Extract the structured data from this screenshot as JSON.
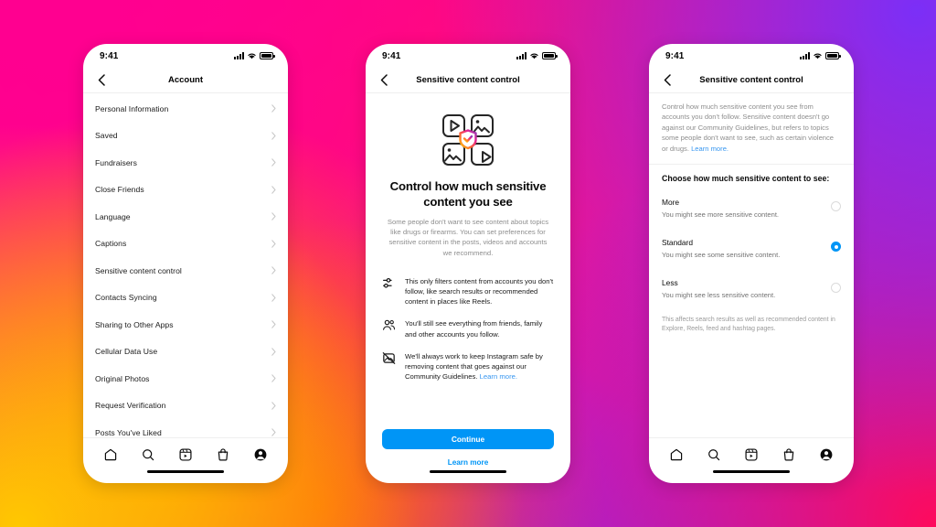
{
  "background": {
    "colors": [
      "#ff0090",
      "#ff0d7a",
      "#ff4a18",
      "#ff9000",
      "#ffc800",
      "#b01fd2",
      "#7b2ff7",
      "#ff0a5c"
    ]
  },
  "accent": {
    "blue": "#0095f6",
    "link": "#3897f0",
    "selected": "#0095f6"
  },
  "status_bar": {
    "time": "9:41",
    "signal_icon": "cellular-bars-icon",
    "wifi_icon": "wifi-icon",
    "battery_icon": "battery-full-icon"
  },
  "tab_bar": {
    "items": [
      {
        "name": "home-tab",
        "icon": "home-icon"
      },
      {
        "name": "search-tab",
        "icon": "search-icon"
      },
      {
        "name": "reels-tab",
        "icon": "reels-icon"
      },
      {
        "name": "shop-tab",
        "icon": "shopping-bag-icon"
      },
      {
        "name": "profile-tab",
        "icon": "profile-person-icon"
      }
    ]
  },
  "phone1": {
    "nav": {
      "back_icon": "chevron-left-icon",
      "title": "Account"
    },
    "list": [
      {
        "label": "Personal Information"
      },
      {
        "label": "Saved"
      },
      {
        "label": "Fundraisers"
      },
      {
        "label": "Close Friends"
      },
      {
        "label": "Language"
      },
      {
        "label": "Captions"
      },
      {
        "label": "Sensitive content control"
      },
      {
        "label": "Contacts Syncing"
      },
      {
        "label": "Sharing to Other Apps"
      },
      {
        "label": "Cellular Data Use"
      },
      {
        "label": "Original Photos"
      },
      {
        "label": "Request Verification"
      },
      {
        "label": "Posts You've Liked"
      }
    ]
  },
  "phone2": {
    "nav": {
      "back_icon": "chevron-left-icon",
      "title": "Sensitive content control"
    },
    "illustration": "shield-check-media-grid-illustration",
    "heading": "Control how much sensitive content you see",
    "subtext": "Some people don't want to see content about topics like drugs or firearms. You can set preferences for sensitive content in the posts, videos and accounts we recommend.",
    "bullets": [
      {
        "icon": "sliders-filter-icon",
        "text": "This only filters content from accounts you don't follow, like search results or recommended content in places like Reels."
      },
      {
        "icon": "people-group-icon",
        "text": "You'll still see everything from friends, family and other accounts you follow."
      },
      {
        "icon": "photo-slash-icon",
        "text": "We'll always work to keep Instagram safe by removing content that goes against our Community Guidelines. ",
        "link": "Learn more."
      }
    ],
    "continue_label": "Continue",
    "learn_more_label": "Learn more"
  },
  "phone3": {
    "nav": {
      "back_icon": "chevron-left-icon",
      "title": "Sensitive content control"
    },
    "intro": "Control how much sensitive content you see from accounts you don't follow. Sensitive content doesn't go against our Community Guidelines, but refers to topics some people don't want to see, such as certain violence or drugs. ",
    "intro_link": "Learn more.",
    "section_heading": "Choose how much sensitive content to see:",
    "options": [
      {
        "title": "More",
        "desc": "You might see more sensitive content.",
        "selected": false
      },
      {
        "title": "Standard",
        "desc": "You might see some sensitive content.",
        "selected": true
      },
      {
        "title": "Less",
        "desc": "You might see less sensitive content.",
        "selected": false
      }
    ],
    "note": "This affects search results as well as recommended content in Explore, Reels, feed and hashtag pages."
  }
}
